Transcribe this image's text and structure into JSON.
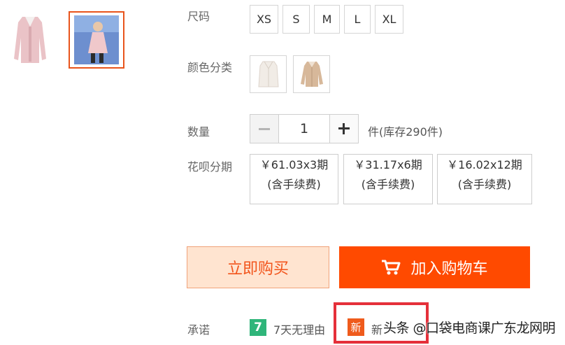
{
  "size": {
    "label": "尺码",
    "options": [
      "XS",
      "S",
      "M",
      "L",
      "XL"
    ]
  },
  "color": {
    "label": "颜色分类"
  },
  "quantity": {
    "label": "数量",
    "value": "1",
    "unit_stock": "件(库存290件)"
  },
  "installment": {
    "label": "花呗分期",
    "plans": [
      {
        "price": "￥61.03x3期",
        "fee": "(含手续费)"
      },
      {
        "price": "￥31.17x6期",
        "fee": "(含手续费)"
      },
      {
        "price": "￥16.02x12期",
        "fee": "(含手续费)"
      }
    ]
  },
  "actions": {
    "buy_now": "立即购买",
    "add_to_cart": "加入购物车"
  },
  "promise": {
    "label": "承诺",
    "badge7": "7",
    "no_reason": "7天无理由",
    "new_badge": "新",
    "new_text": "新",
    "watermark": "头条 @口袋电商课广东龙网明"
  },
  "colors": {
    "accent": "#ff4a00",
    "highlight_red": "#e5303a",
    "green_badge": "#2fb57a"
  }
}
